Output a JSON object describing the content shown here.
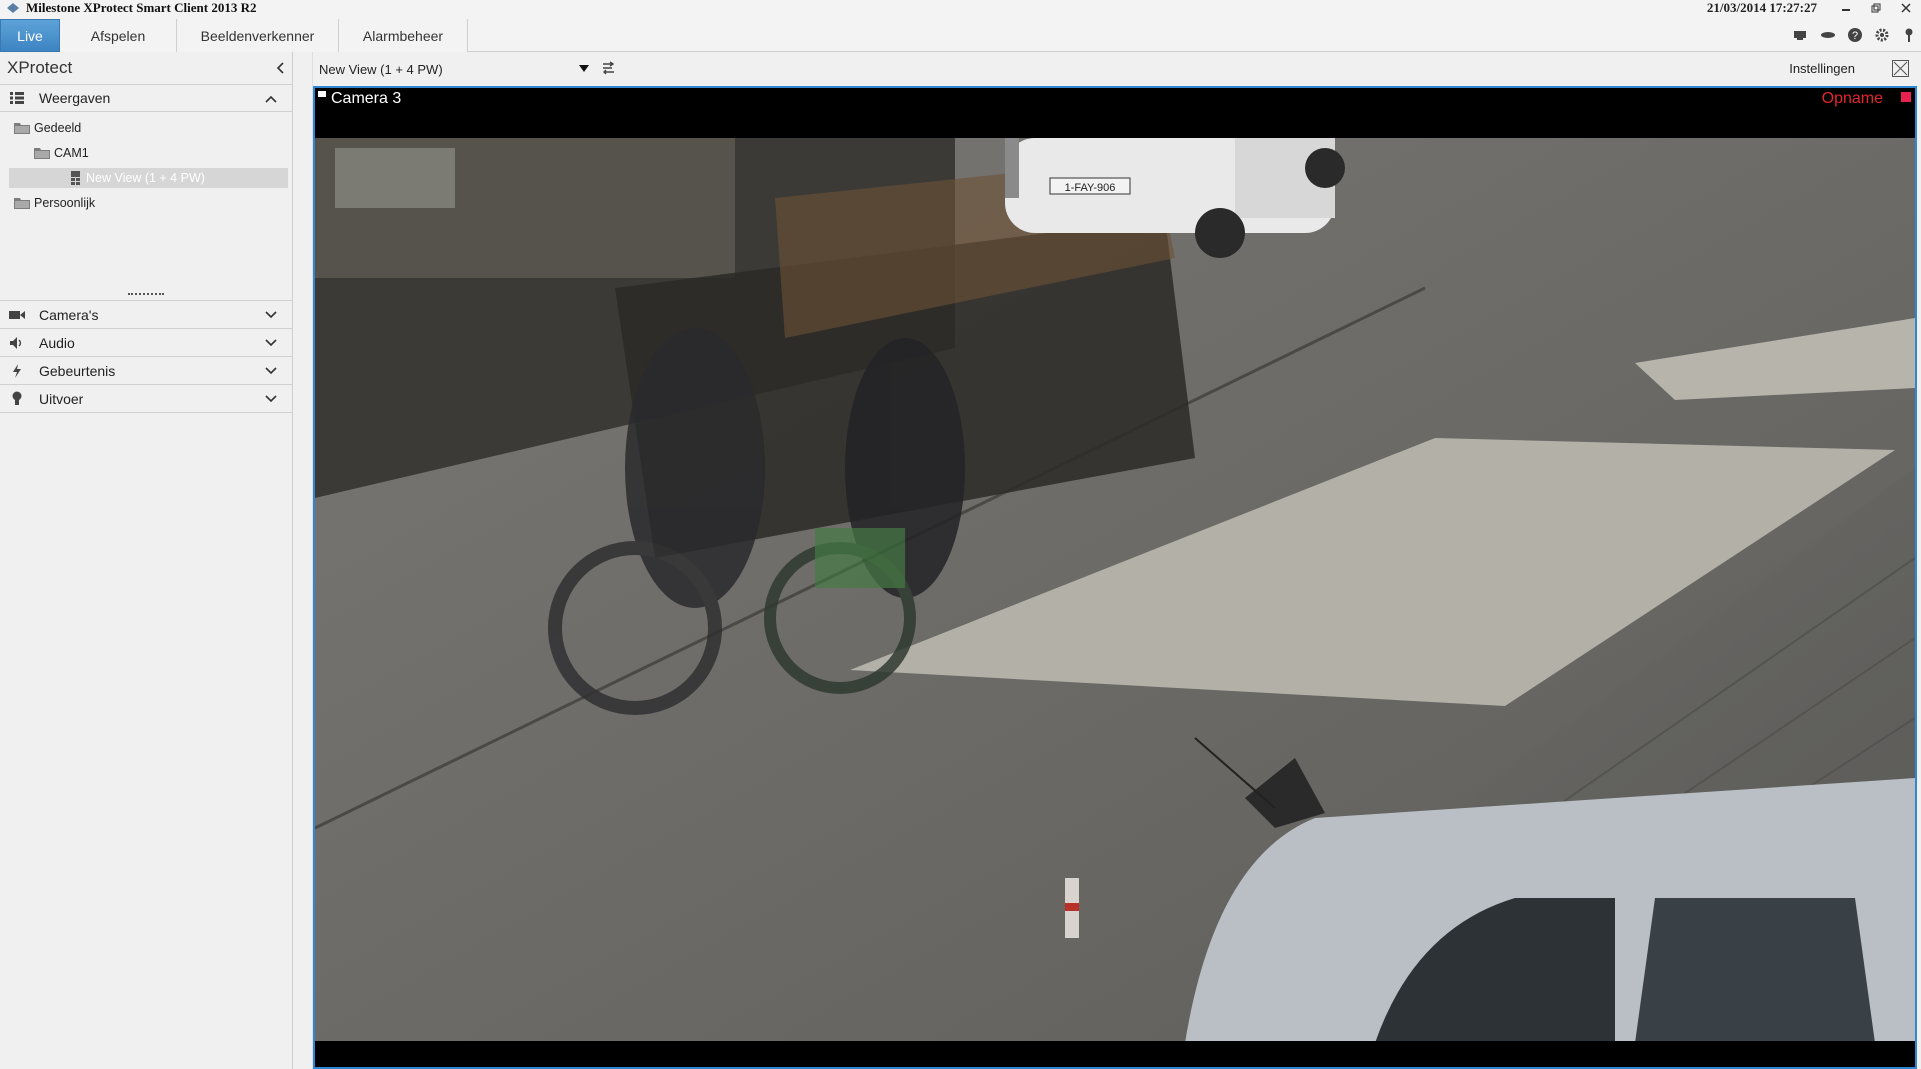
{
  "window": {
    "title": "Milestone XProtect Smart Client 2013 R2",
    "datetime": "21/03/2014 17:27:27"
  },
  "tabs": [
    {
      "label": "Live",
      "active": true
    },
    {
      "label": "Afspelen",
      "active": false
    },
    {
      "label": "Beeldenverkenner",
      "active": false
    },
    {
      "label": "Alarmbeheer",
      "active": false
    }
  ],
  "toolbar_icons": [
    "monitor-icon",
    "link-icon",
    "help-icon",
    "gear-icon",
    "pin-icon"
  ],
  "sidebar": {
    "title": "XProtect",
    "views_section": "Weergaven",
    "tree": {
      "shared": "Gedeeld",
      "cam1": "CAM1",
      "selected_view": "New View (1 + 4 PW)",
      "personal": "Persoonlijk"
    },
    "sections": [
      {
        "label": "Camera's",
        "icon": "camera-icon"
      },
      {
        "label": "Audio",
        "icon": "speaker-icon"
      },
      {
        "label": "Gebeurtenis",
        "icon": "lightning-icon"
      },
      {
        "label": "Uitvoer",
        "icon": "bulb-icon"
      }
    ]
  },
  "viewbar": {
    "view_name": "New View (1 + 4 PW)",
    "settings": "Instellingen"
  },
  "camera": {
    "name": "Camera 3",
    "recording_label": "Opname",
    "plate": "1-FAY-906"
  },
  "colors": {
    "accent": "#3d84c3",
    "recording": "#e2262a",
    "frame_border": "#2f86d2"
  }
}
